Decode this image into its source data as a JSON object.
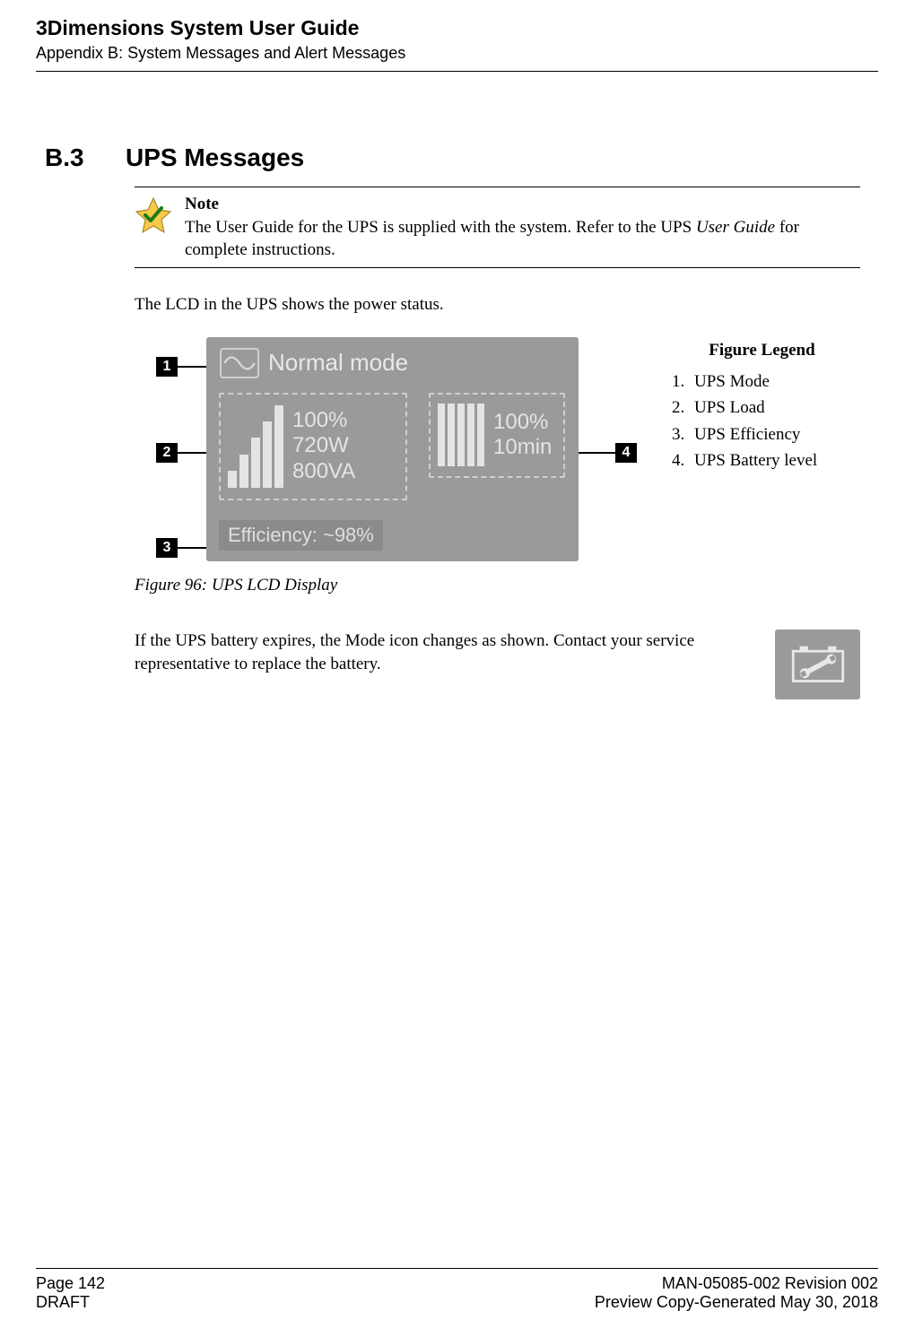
{
  "header": {
    "title": "3Dimensions System User Guide",
    "subtitle": "Appendix B: System Messages and Alert Messages"
  },
  "section": {
    "number": "B.3",
    "title": "UPS Messages"
  },
  "note": {
    "label": "Note",
    "text_1": "The User Guide for the UPS is supplied with the system. Refer to the UPS ",
    "text_italic": "User Guide",
    "text_2": " for complete instructions."
  },
  "intro_para": "The LCD in the UPS shows the power status.",
  "lcd": {
    "mode": "Normal mode",
    "load_percent": "100%",
    "load_watts": "720W",
    "load_va": "800VA",
    "batt_percent": "100%",
    "batt_time": "10min",
    "efficiency": "Efficiency: ~98%",
    "callout_1": "1",
    "callout_2": "2",
    "callout_3": "3",
    "callout_4": "4"
  },
  "figure_caption": "Figure 96: UPS LCD Display",
  "legend": {
    "title": "Figure Legend",
    "items": [
      "UPS Mode",
      "UPS Load",
      "UPS Efficiency",
      "UPS Battery level"
    ]
  },
  "expiry_para": "If the UPS battery expires, the Mode icon changes as shown. Contact your service representative to replace the battery.",
  "footer": {
    "page": "Page 142",
    "draft": "DRAFT",
    "docnum": "MAN-05085-002 Revision 002",
    "preview": "Preview Copy-Generated May 30, 2018"
  }
}
